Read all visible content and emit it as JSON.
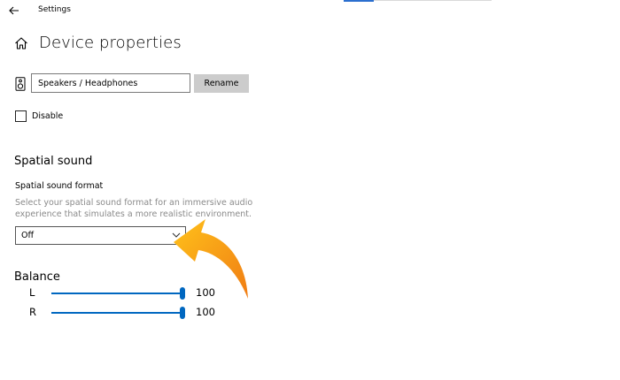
{
  "window": {
    "title": "Settings"
  },
  "page": {
    "title": "Device properties"
  },
  "device": {
    "name": "Speakers / Headphones",
    "rename_label": "Rename"
  },
  "disable": {
    "label": "Disable",
    "checked": false
  },
  "spatial": {
    "section_title": "Spatial sound",
    "field_label": "Spatial sound format",
    "description": "Select your spatial sound format for an immersive audio experience that simulates a more realistic environment.",
    "selected": "Off"
  },
  "balance": {
    "title": "Balance",
    "channels": [
      {
        "label": "L",
        "value": "100",
        "level": 1.0
      },
      {
        "label": "R",
        "value": "100",
        "level": 1.0
      }
    ]
  },
  "colors": {
    "accent": "#0067c0",
    "arrow": "#f39a1f"
  }
}
